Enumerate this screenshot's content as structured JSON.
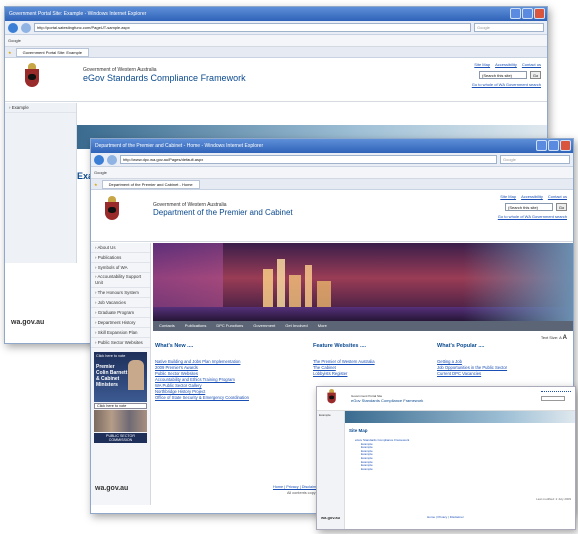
{
  "window1": {
    "title": "Government Portal Site: Example - Windows Internet Explorer",
    "address": "http://portal.satestingfunc.com/PageUT-sample.aspx",
    "search_placeholder": "Google",
    "toolbar": "Google",
    "tab": "Government Portal Site: Example",
    "org_name": "Government of Western Australia",
    "site_name": "eGov Standards Compliance Framework",
    "links": [
      "Site Map",
      "Accessibility",
      "Contact us"
    ],
    "search_value": "(Search this site)",
    "search_go": "Go",
    "search_link": "Go to whole of WA Government search",
    "sidebar_item": "Example",
    "page_heading": "Exam",
    "footer_logo": "wa.gov.au"
  },
  "window2": {
    "title": "Department of the Premier and Cabinet - Home - Windows Internet Explorer",
    "address": "http://www.dpc.wa.gov.au/Pages/default.aspx",
    "search_placeholder": "Google",
    "toolbar": "Google",
    "tab": "Department of the Premier and Cabinet - Home",
    "org_name": "Government of Western Australia",
    "site_name": "Department of the Premier and Cabinet",
    "links": [
      "Site Map",
      "Accessibility",
      "Contact us"
    ],
    "search_value": "(Search this site)",
    "search_go": "Go",
    "search_link": "Go to whole of WA Government search",
    "sidebar": [
      "About Us",
      "Publications",
      "Symbols of WA",
      "Accountability Support Unit",
      "The Honours System",
      "Job Vacancies",
      "Graduate Program",
      "Department History",
      "Skill Expansion Plan",
      "Public Sector Websites"
    ],
    "promo_top": "Click here to vote",
    "promo_name": "Premier Colin Barnett & Cabinet Ministers",
    "promo_link": "Click here to vote",
    "promo_bottom": "PUBLIC SECTOR COMMISSION",
    "menu": [
      "Contacts",
      "Publications",
      "DPC Functions",
      "Government",
      "Get Involved",
      "More"
    ],
    "text_size": "Text Size:",
    "cols": [
      {
        "title": "What's New ....",
        "links": [
          "Native Building and Jobs Plan Implementation",
          "2009 Premier's Awards",
          "Public Sector Websites",
          "Accountability and Ethics Training Program",
          "WA Public Sector Gallery",
          "Northbridge History Project",
          "Office of State Security & Emergency Coordination"
        ]
      },
      {
        "title": "Feature Websites ....",
        "links": [
          "The Premier of Western Australia",
          "The Cabinet",
          "Lobbyists Register"
        ]
      },
      {
        "title": "What's Popular ....",
        "links": [
          "Getting a Job",
          "Job Opportunities in the Public Sector",
          "Current DPC Vacancies"
        ]
      }
    ],
    "footer_logo": "wa.gov.au",
    "footer_links": "Home | Privacy | Disclaimer",
    "footer_copy": "All contents copyright"
  },
  "window3": {
    "org_name": "Government Portal Site",
    "site_name": "eGov Standards Compliance Framework",
    "sidebar_item": "Example",
    "heading": "Site Map",
    "tree_title": "eGov Standards Compliance Framework",
    "tree_items": [
      "Example",
      "Example",
      "Example",
      "Example",
      "Example",
      "Example",
      "Example",
      "Example"
    ],
    "footer_logo": "wa.gov.au",
    "footer_note": "Home | Privacy | Disclaimer",
    "last_updated": "Last modified: 2 July 2009"
  }
}
